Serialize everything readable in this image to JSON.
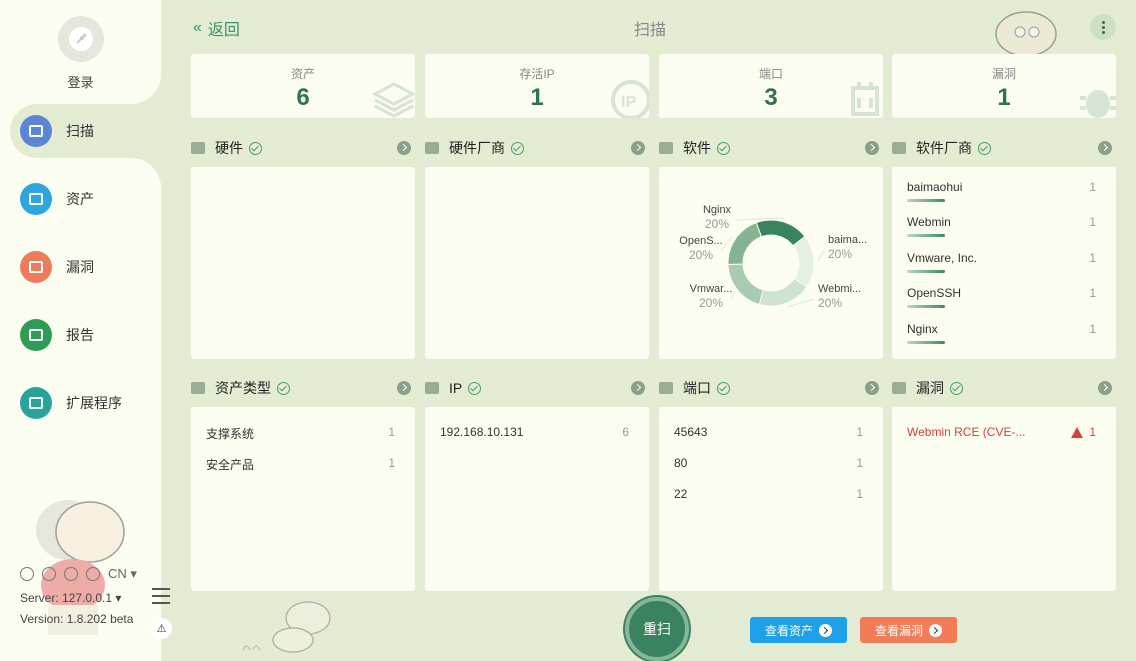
{
  "sidebar": {
    "login_label": "登录",
    "items": [
      {
        "label": "扫描",
        "color": "#5b86d6",
        "icon": "scan-icon"
      },
      {
        "label": "资产",
        "color": "#2ea6dd",
        "icon": "asset-icon"
      },
      {
        "label": "漏洞",
        "color": "#ee7c5c",
        "icon": "bug-icon"
      },
      {
        "label": "报告",
        "color": "#2f9c55",
        "icon": "report-icon"
      },
      {
        "label": "扩展程序",
        "color": "#27a59a",
        "icon": "plugin-icon"
      }
    ],
    "lang": "CN",
    "server": "Server: 127.0.0.1",
    "version": "Version: 1.8.202 beta"
  },
  "header": {
    "back_label": "返回",
    "back_glyph": "«",
    "title": "扫描"
  },
  "stats": [
    {
      "label": "资产",
      "value": "6"
    },
    {
      "label": "存活IP",
      "value": "1"
    },
    {
      "label": "端口",
      "value": "3"
    },
    {
      "label": "漏洞",
      "value": "1"
    }
  ],
  "sections": {
    "hardware": {
      "title": "硬件"
    },
    "hardware_vendor": {
      "title": "硬件厂商"
    },
    "software": {
      "title": "软件"
    },
    "software_vendor": {
      "title": "软件厂商",
      "rows": [
        {
          "name": "baimaohui",
          "count": "1"
        },
        {
          "name": "Webmin",
          "count": "1"
        },
        {
          "name": "Vmware, Inc.",
          "count": "1"
        },
        {
          "name": "OpenSSH",
          "count": "1"
        },
        {
          "name": "Nginx",
          "count": "1"
        }
      ]
    },
    "asset_type": {
      "title": "资产类型",
      "rows": [
        {
          "name": "支撑系统",
          "count": "1"
        },
        {
          "name": "安全产品",
          "count": "1"
        }
      ]
    },
    "ip": {
      "title": "IP",
      "rows": [
        {
          "name": "192.168.10.131",
          "count": "6"
        }
      ]
    },
    "port": {
      "title": "端口",
      "rows": [
        {
          "name": "45643",
          "count": "1"
        },
        {
          "name": "80",
          "count": "1"
        },
        {
          "name": "22",
          "count": "1"
        }
      ]
    },
    "vuln": {
      "title": "漏洞",
      "rows": [
        {
          "name": "Webmin RCE (CVE-...",
          "count": "1"
        }
      ]
    }
  },
  "chart_data": {
    "type": "pie",
    "labels": [
      "Nginx",
      "baima...",
      "Webmi...",
      "Vmwar...",
      "OpenS..."
    ],
    "values": [
      20,
      20,
      20,
      20,
      20
    ],
    "value_labels": [
      "20%",
      "20%",
      "20%",
      "20%",
      "20%"
    ],
    "colors": [
      "#3a8360",
      "#e5f0e0",
      "#cde3cf",
      "#a8cbb1",
      "#86b493"
    ]
  },
  "actions": {
    "rescan": "重扫",
    "view_assets": "查看资产",
    "view_vulns": "查看漏洞",
    "view_assets_color": "#1fa1ea",
    "view_vulns_color": "#f27c57"
  }
}
